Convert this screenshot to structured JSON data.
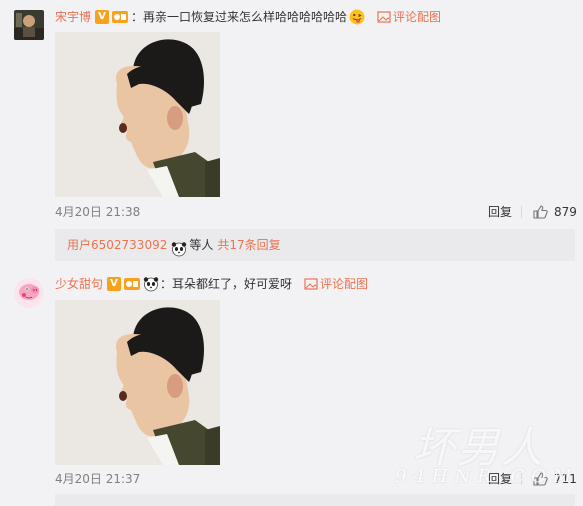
{
  "comments": [
    {
      "username": "宋宇博",
      "v_badge": "V",
      "text": "再亲一口恢复过来怎么样哈哈哈哈哈哈",
      "pic_link": "评论配图",
      "time": "4月20日 21:38",
      "reply": "回复",
      "likes": "879",
      "avatar_icon": "user-avatar-dark",
      "emoji_icon": "grinning-tongue-emoji",
      "photo_icon": "profile-photo-man-surprised"
    },
    {
      "username": "少女甜句",
      "v_badge": "V",
      "text": "耳朵都红了，好可爱呀",
      "pic_link": "评论配图",
      "time": "4月20日 21:37",
      "reply": "回复",
      "likes": "711",
      "avatar_icon": "peppa-pig-avatar",
      "emoji_icon": "panda-emoji",
      "photo_icon": "profile-photo-man-surprised"
    }
  ],
  "subreply": {
    "user": "用户6502733092",
    "text": "等人",
    "more": "共17条回复",
    "emoji_icon": "panda-emoji"
  },
  "watermark": {
    "line1": "坏男人",
    "line2": "94HNR.COM"
  },
  "colors": {
    "accent": "#eb7350",
    "background": "#f2f2f5",
    "subbox": "#eaeaec"
  }
}
